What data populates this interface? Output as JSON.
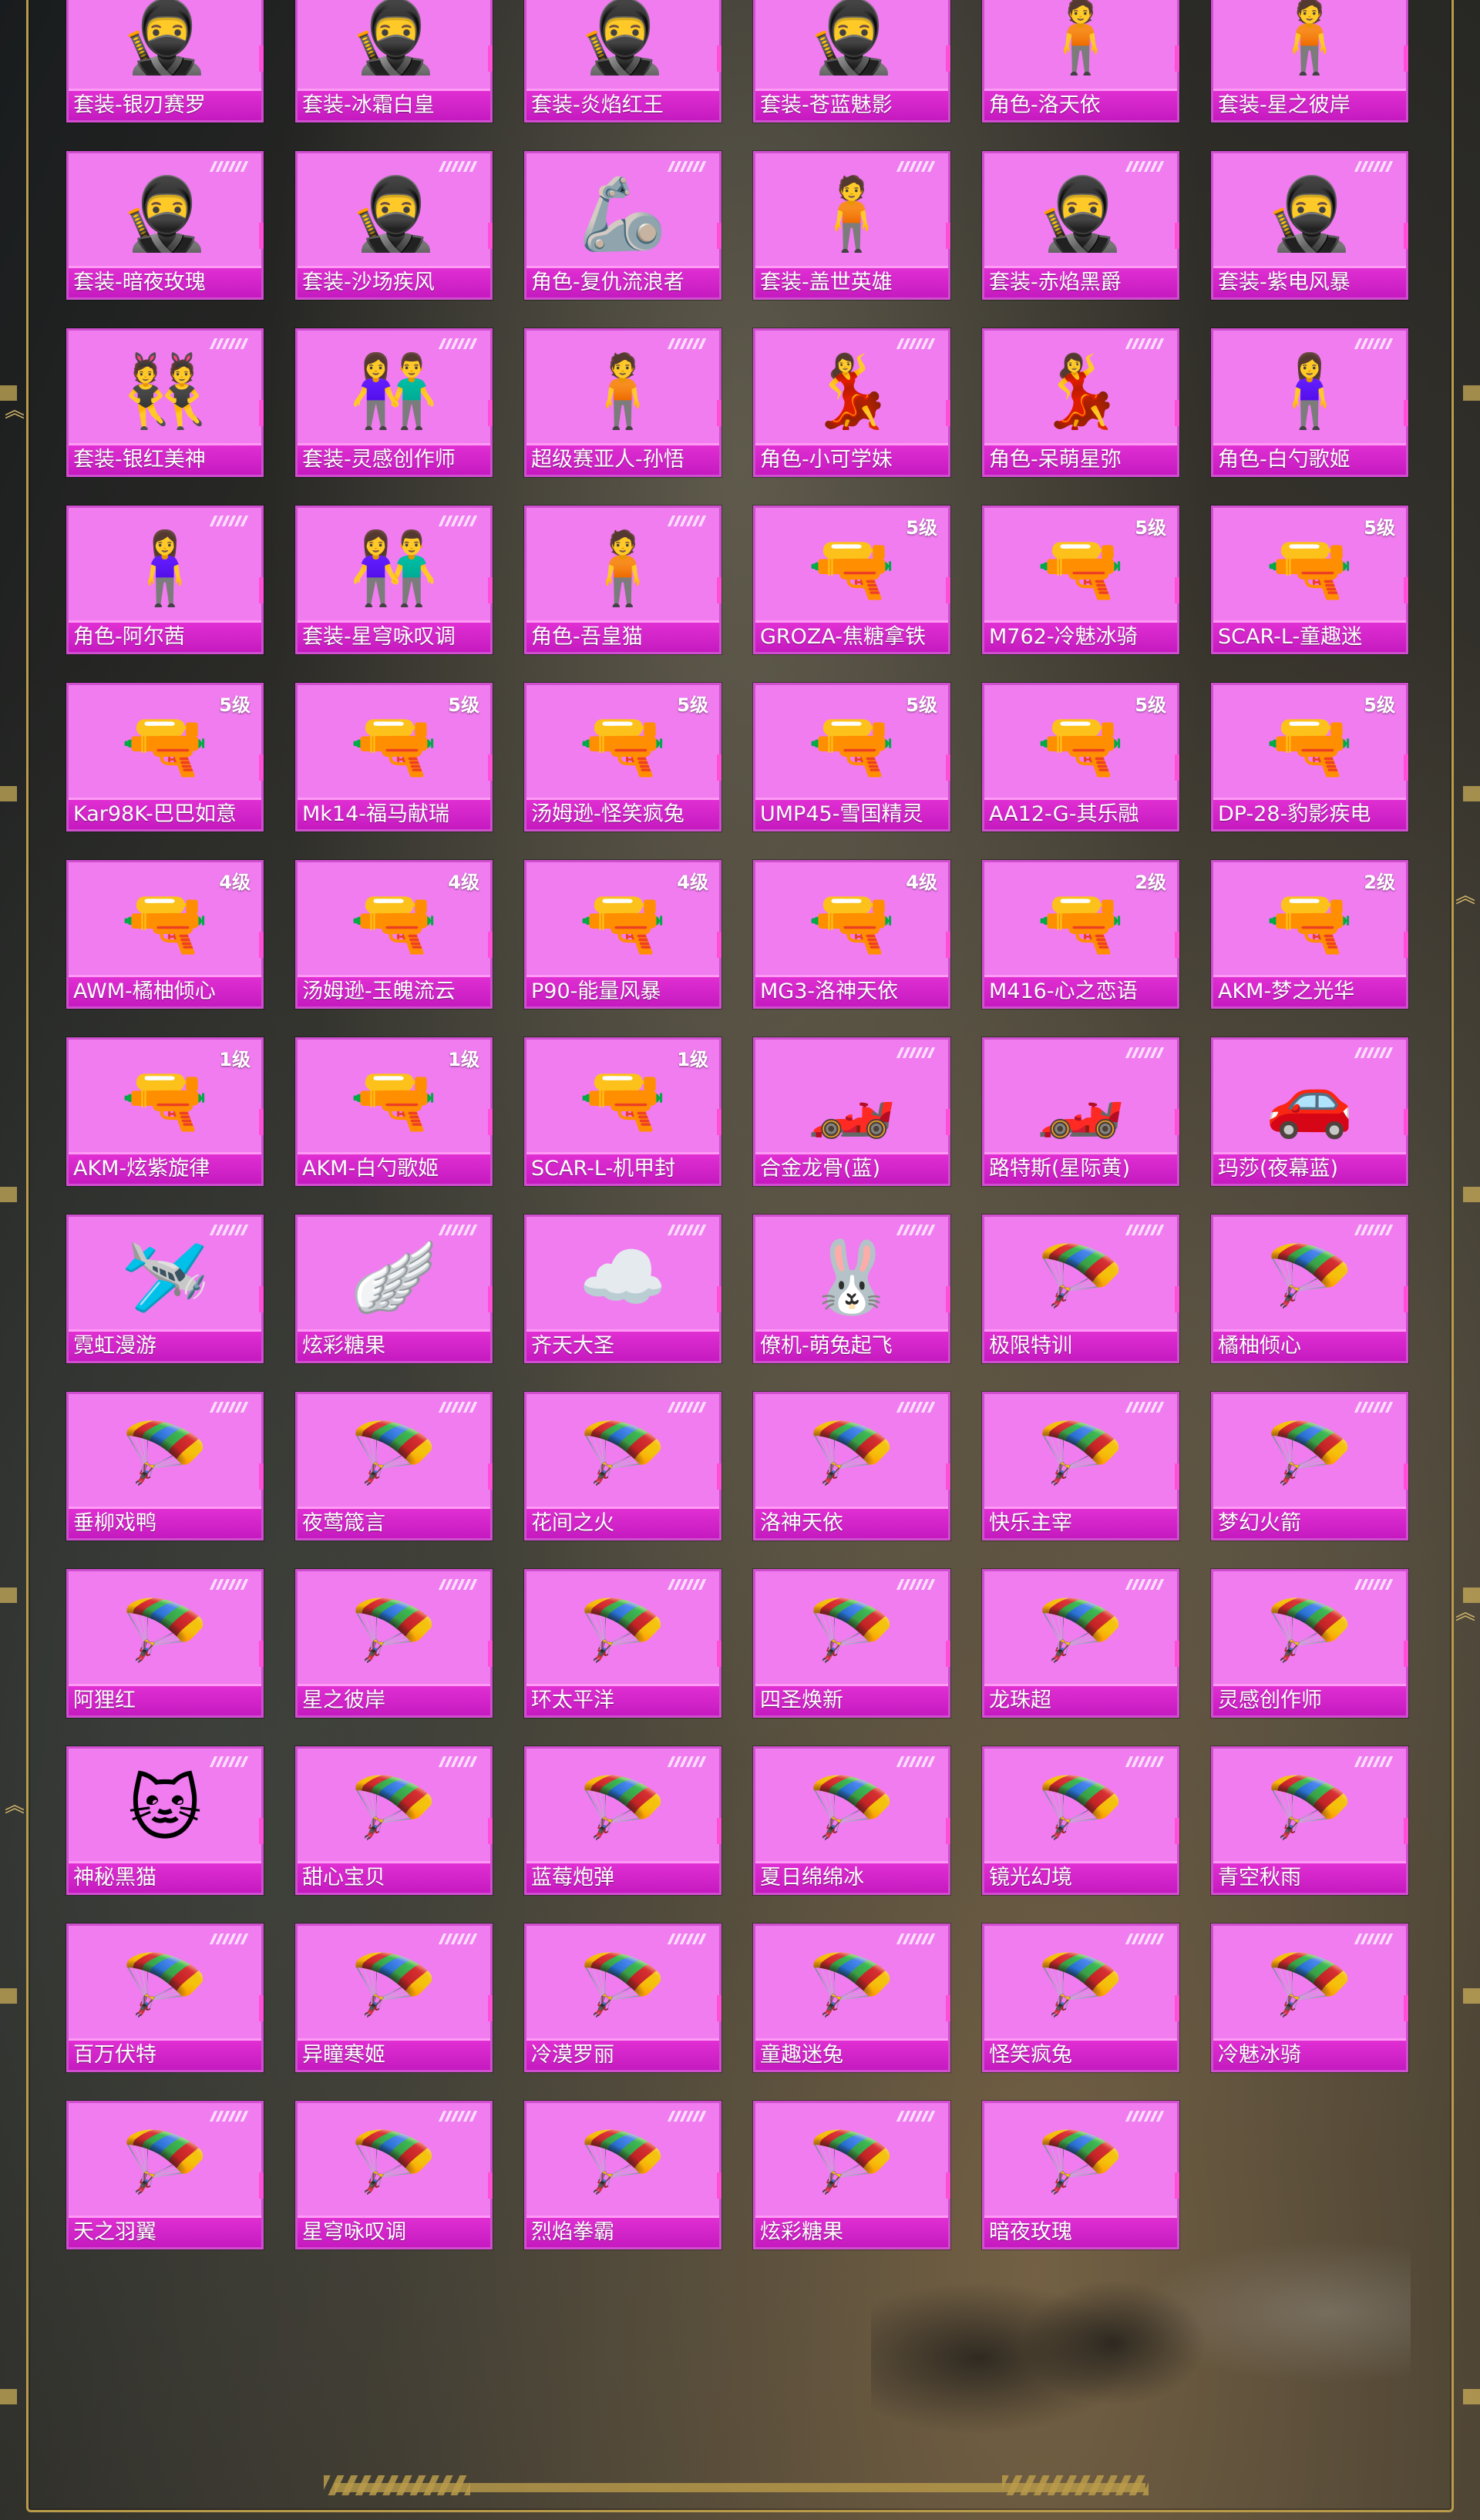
{
  "colors": {
    "card_bg": "#f07cf0",
    "label_bg": "#c51ac0",
    "frame_gold": "#b99b4a"
  },
  "items": [
    {
      "label": "套装-银刃赛罗",
      "tier": "",
      "icon": "armored-suit-icon",
      "glyph": "🥷"
    },
    {
      "label": "套装-冰霜白皇",
      "tier": "",
      "icon": "armored-suit-icon",
      "glyph": "🥷"
    },
    {
      "label": "套装-炎焰红王",
      "tier": "",
      "icon": "armored-suit-icon",
      "glyph": "🥷"
    },
    {
      "label": "套装-苍蓝魅影",
      "tier": "",
      "icon": "armored-suit-icon",
      "glyph": "🥷"
    },
    {
      "label": "角色-洛天依",
      "tier": "",
      "icon": "character-icon",
      "glyph": "🧍"
    },
    {
      "label": "套装-星之彼岸",
      "tier": "",
      "icon": "outfit-icon",
      "glyph": "🧍"
    },
    {
      "label": "套装-暗夜玫瑰",
      "tier": "",
      "icon": "outfit-pair-icon",
      "glyph": "🥷"
    },
    {
      "label": "套装-沙场疾风",
      "tier": "",
      "icon": "outfit-pair-icon",
      "glyph": "🥷"
    },
    {
      "label": "角色-复仇流浪者",
      "tier": "",
      "icon": "character-icon",
      "glyph": "🦾"
    },
    {
      "label": "套装-盖世英雄",
      "tier": "",
      "icon": "outfit-icon",
      "glyph": "🧍"
    },
    {
      "label": "套装-赤焰黑爵",
      "tier": "",
      "icon": "outfit-pair-icon",
      "glyph": "🥷"
    },
    {
      "label": "套装-紫电风暴",
      "tier": "",
      "icon": "outfit-pair-icon",
      "glyph": "🥷"
    },
    {
      "label": "套装-银红美神",
      "tier": "",
      "icon": "outfit-pair-icon",
      "glyph": "👯"
    },
    {
      "label": "套装-灵感创作师",
      "tier": "",
      "icon": "outfit-pair-icon",
      "glyph": "👫"
    },
    {
      "label": "超级赛亚人-孙悟",
      "tier": "",
      "icon": "character-icon",
      "glyph": "🧍"
    },
    {
      "label": "角色-小可学妹",
      "tier": "",
      "icon": "character-icon",
      "glyph": "💃"
    },
    {
      "label": "角色-呆萌星弥",
      "tier": "",
      "icon": "character-icon",
      "glyph": "💃"
    },
    {
      "label": "角色-白勺歌姬",
      "tier": "",
      "icon": "character-icon",
      "glyph": "🧍‍♀️"
    },
    {
      "label": "角色-阿尔茜",
      "tier": "",
      "icon": "character-icon",
      "glyph": "🧍‍♀️"
    },
    {
      "label": "套装-星穹咏叹调",
      "tier": "",
      "icon": "outfit-pair-icon",
      "glyph": "👫"
    },
    {
      "label": "角色-吾皇猫",
      "tier": "",
      "icon": "character-icon",
      "glyph": "🧍"
    },
    {
      "label": "GROZA-焦糖拿铁",
      "tier": "5级",
      "icon": "rifle-icon",
      "glyph": "🔫"
    },
    {
      "label": "M762-冷魅冰骑",
      "tier": "5级",
      "icon": "rifle-icon",
      "glyph": "🔫"
    },
    {
      "label": "SCAR-L-童趣迷",
      "tier": "5级",
      "icon": "rifle-icon",
      "glyph": "🔫"
    },
    {
      "label": "Kar98K-巴巴如意",
      "tier": "5级",
      "icon": "sniper-rifle-icon",
      "glyph": "🔫"
    },
    {
      "label": "Mk14-福马献瑞",
      "tier": "5级",
      "icon": "rifle-icon",
      "glyph": "🔫"
    },
    {
      "label": "汤姆逊-怪笑疯兔",
      "tier": "5级",
      "icon": "smg-icon",
      "glyph": "🔫"
    },
    {
      "label": "UMP45-雪国精灵",
      "tier": "5级",
      "icon": "smg-icon",
      "glyph": "🔫"
    },
    {
      "label": "AA12-G-其乐融",
      "tier": "5级",
      "icon": "shotgun-icon",
      "glyph": "🔫"
    },
    {
      "label": "DP-28-豹影疾电",
      "tier": "5级",
      "icon": "lmg-icon",
      "glyph": "🔫"
    },
    {
      "label": "AWM-橘柚倾心",
      "tier": "4级",
      "icon": "sniper-rifle-icon",
      "glyph": "🔫"
    },
    {
      "label": "汤姆逊-玉魄流云",
      "tier": "4级",
      "icon": "smg-icon",
      "glyph": "🔫"
    },
    {
      "label": "P90-能量风暴",
      "tier": "4级",
      "icon": "smg-icon",
      "glyph": "🔫"
    },
    {
      "label": "MG3-洛神天依",
      "tier": "4级",
      "icon": "lmg-icon",
      "glyph": "🔫"
    },
    {
      "label": "M416-心之恋语",
      "tier": "2级",
      "icon": "rifle-icon",
      "glyph": "🔫"
    },
    {
      "label": "AKM-梦之光华",
      "tier": "2级",
      "icon": "rifle-icon",
      "glyph": "🔫"
    },
    {
      "label": "AKM-炫紫旋律",
      "tier": "1级",
      "icon": "rifle-icon",
      "glyph": "🔫"
    },
    {
      "label": "AKM-白勺歌姬",
      "tier": "1级",
      "icon": "rifle-icon",
      "glyph": "🔫"
    },
    {
      "label": "SCAR-L-机甲封",
      "tier": "1级",
      "icon": "rifle-icon",
      "glyph": "🔫"
    },
    {
      "label": "合金龙骨(蓝)",
      "tier": "",
      "icon": "race-car-icon",
      "glyph": "🏎️"
    },
    {
      "label": "路特斯(星际黄)",
      "tier": "",
      "icon": "sports-car-icon",
      "glyph": "🏎️"
    },
    {
      "label": "玛莎(夜幕蓝)",
      "tier": "",
      "icon": "sedan-car-icon",
      "glyph": "🚗"
    },
    {
      "label": "霓虹漫游",
      "tier": "",
      "icon": "glider-icon",
      "glyph": "🛩️"
    },
    {
      "label": "炫彩糖果",
      "tier": "",
      "icon": "glider-icon",
      "glyph": "🪽"
    },
    {
      "label": "齐天大圣",
      "tier": "",
      "icon": "cloud-icon",
      "glyph": "☁️"
    },
    {
      "label": "僚机-萌兔起飞",
      "tier": "",
      "icon": "bunny-drone-icon",
      "glyph": "🐰"
    },
    {
      "label": "极限特训",
      "tier": "",
      "icon": "parachute-icon",
      "glyph": "🪂"
    },
    {
      "label": "橘柚倾心",
      "tier": "",
      "icon": "parachute-icon",
      "glyph": "🪂"
    },
    {
      "label": "垂柳戏鸭",
      "tier": "",
      "icon": "parachute-icon",
      "glyph": "🪂"
    },
    {
      "label": "夜莺箴言",
      "tier": "",
      "icon": "parachute-icon",
      "glyph": "🪂"
    },
    {
      "label": "花间之火",
      "tier": "",
      "icon": "parachute-icon",
      "glyph": "🪂"
    },
    {
      "label": "洛神天依",
      "tier": "",
      "icon": "parachute-icon",
      "glyph": "🪂"
    },
    {
      "label": "快乐主宰",
      "tier": "",
      "icon": "parachute-icon",
      "glyph": "🪂"
    },
    {
      "label": "梦幻火箭",
      "tier": "",
      "icon": "parachute-icon",
      "glyph": "🪂"
    },
    {
      "label": "阿狸红",
      "tier": "",
      "icon": "parachute-icon",
      "glyph": "🪂"
    },
    {
      "label": "星之彼岸",
      "tier": "",
      "icon": "parachute-icon",
      "glyph": "🪂"
    },
    {
      "label": "环太平洋",
      "tier": "",
      "icon": "parachute-icon",
      "glyph": "🪂"
    },
    {
      "label": "四圣焕新",
      "tier": "",
      "icon": "parachute-icon",
      "glyph": "🪂"
    },
    {
      "label": "龙珠超",
      "tier": "",
      "icon": "parachute-icon",
      "glyph": "🪂"
    },
    {
      "label": "灵感创作师",
      "tier": "",
      "icon": "parachute-icon",
      "glyph": "🪂"
    },
    {
      "label": "神秘黑猫",
      "tier": "",
      "icon": "cat-parachute-icon",
      "glyph": "🐱"
    },
    {
      "label": "甜心宝贝",
      "tier": "",
      "icon": "parachute-icon",
      "glyph": "🪂"
    },
    {
      "label": "蓝莓炮弹",
      "tier": "",
      "icon": "parachute-icon",
      "glyph": "🪂"
    },
    {
      "label": "夏日绵绵冰",
      "tier": "",
      "icon": "parachute-icon",
      "glyph": "🪂"
    },
    {
      "label": "镜光幻境",
      "tier": "",
      "icon": "parachute-icon",
      "glyph": "🪂"
    },
    {
      "label": "青空秋雨",
      "tier": "",
      "icon": "parachute-icon",
      "glyph": "🪂"
    },
    {
      "label": "百万伏特",
      "tier": "",
      "icon": "parachute-icon",
      "glyph": "🪂"
    },
    {
      "label": "异瞳寒姬",
      "tier": "",
      "icon": "parachute-icon",
      "glyph": "🪂"
    },
    {
      "label": "冷漠罗丽",
      "tier": "",
      "icon": "parachute-icon",
      "glyph": "🪂"
    },
    {
      "label": "童趣迷兔",
      "tier": "",
      "icon": "parachute-icon",
      "glyph": "🪂"
    },
    {
      "label": "怪笑疯兔",
      "tier": "",
      "icon": "parachute-icon",
      "glyph": "🪂"
    },
    {
      "label": "冷魅冰骑",
      "tier": "",
      "icon": "parachute-icon",
      "glyph": "🪂"
    },
    {
      "label": "天之羽翼",
      "tier": "",
      "icon": "parachute-icon",
      "glyph": "🪂"
    },
    {
      "label": "星穹咏叹调",
      "tier": "",
      "icon": "parachute-icon",
      "glyph": "🪂"
    },
    {
      "label": "烈焰拳霸",
      "tier": "",
      "icon": "parachute-icon",
      "glyph": "🪂"
    },
    {
      "label": "炫彩糖果",
      "tier": "",
      "icon": "parachute-icon",
      "glyph": "🪂"
    },
    {
      "label": "暗夜玫瑰",
      "tier": "",
      "icon": "parachute-icon",
      "glyph": "🪂"
    }
  ]
}
